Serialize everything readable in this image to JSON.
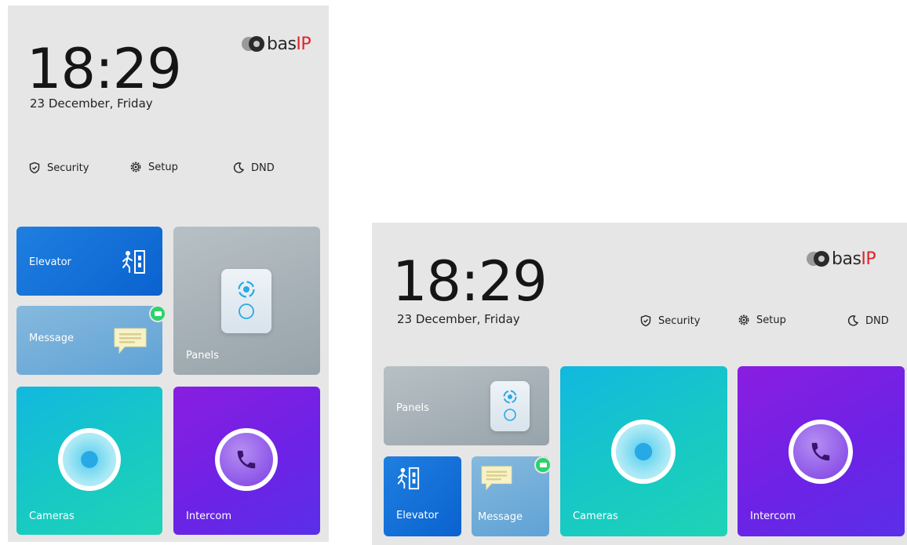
{
  "portrait": {
    "time": "18:29",
    "date": "23 December, Friday",
    "logo": {
      "brand": "bas",
      "brand_suffix": "IP"
    },
    "quick_actions": [
      {
        "label": "Security",
        "icon": "shield-icon"
      },
      {
        "label": "Setup",
        "icon": "gear-icon"
      },
      {
        "label": "DND",
        "icon": "moon-icon"
      }
    ],
    "tiles": {
      "elevator": "Elevator",
      "message": "Message",
      "panels": "Panels",
      "cameras": "Cameras",
      "intercom": "Intercom"
    }
  },
  "landscape": {
    "time": "18:29",
    "date": "23 December, Friday",
    "logo": {
      "brand": "bas",
      "brand_suffix": "IP"
    },
    "quick_actions": [
      {
        "label": "Security",
        "icon": "shield-icon"
      },
      {
        "label": "Setup",
        "icon": "gear-icon"
      },
      {
        "label": "DND",
        "icon": "moon-icon"
      }
    ],
    "tiles": {
      "panels": "Panels",
      "elevator": "Elevator",
      "message": "Message",
      "cameras": "Cameras",
      "intercom": "Intercom"
    }
  },
  "colors": {
    "elevator": "#0a62cf",
    "message": "#5fa2d6",
    "panels": "#97a3aa",
    "cameras": "#17c9c4",
    "intercom": "#6d22e6",
    "badge": "#2bd36a",
    "logo_accent": "#e0232b"
  }
}
